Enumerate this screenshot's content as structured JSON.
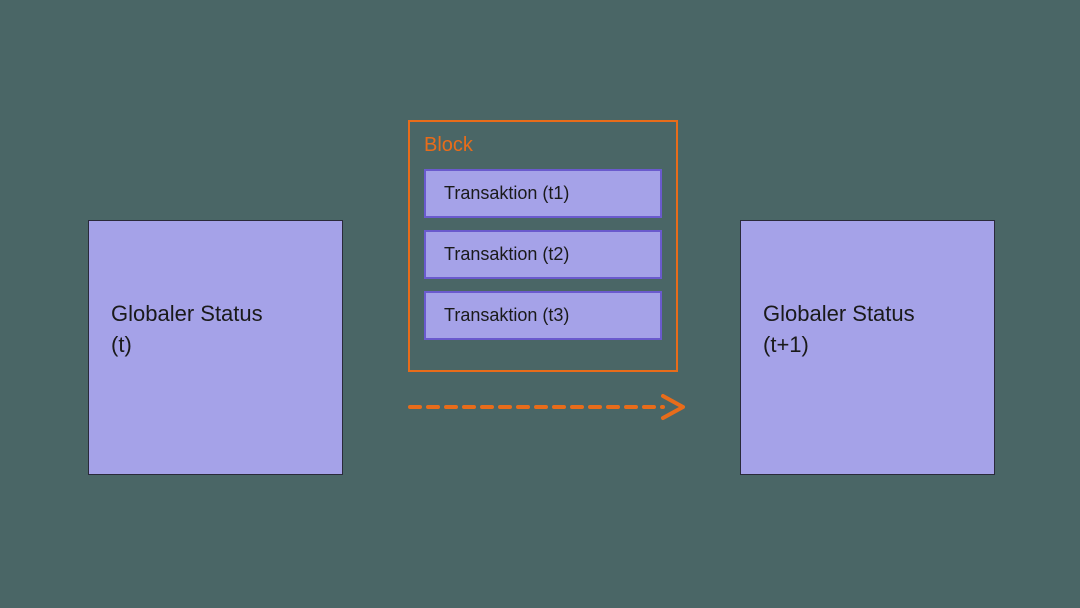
{
  "left_state": {
    "line1": "Globaler Status",
    "line2": "(t)"
  },
  "right_state": {
    "line1": "Globaler Status",
    "line2": "(t+1)"
  },
  "block": {
    "title": "Block",
    "transactions": [
      "Transaktion (t1)",
      "Transaktion (t2)",
      "Transaktion (t3)"
    ]
  },
  "colors": {
    "background": "#4a6666",
    "box_fill": "#a5a2e8",
    "box_border": "#6a5acd",
    "accent": "#e86c1a"
  }
}
